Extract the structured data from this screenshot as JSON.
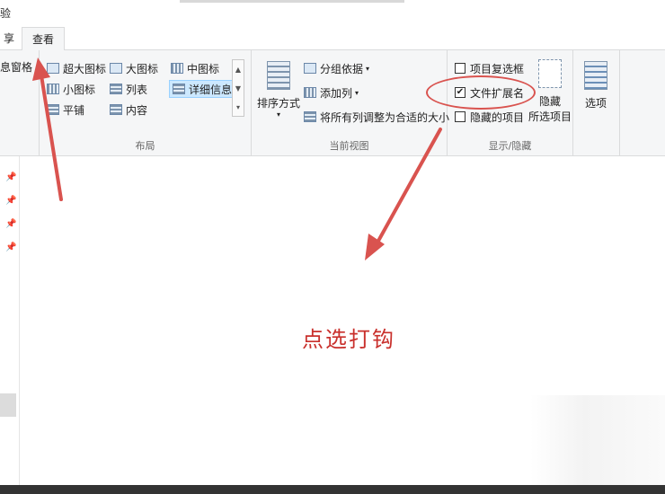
{
  "window": {
    "title_fragment": "验"
  },
  "tabs": {
    "share": "享",
    "view": "查看"
  },
  "pane_group": {
    "details_pane": "息窗格"
  },
  "layout": {
    "items": [
      "超大图标",
      "大图标",
      "中图标",
      "小图标",
      "列表",
      "详细信息",
      "平铺",
      "内容"
    ],
    "selected": "详细信息",
    "group_label": "布局"
  },
  "current_view": {
    "sort_by": "排序方式",
    "group_by": "分组依据",
    "add_columns": "添加列",
    "size_columns": "将所有列调整为合适的大小",
    "group_label": "当前视图"
  },
  "show_hide": {
    "item_checkboxes": {
      "label": "项目复选框",
      "checked": false
    },
    "file_extensions": {
      "label": "文件扩展名",
      "checked": true
    },
    "hidden_items": {
      "label": "隐藏的项目",
      "checked": false
    },
    "hide_selected": {
      "line1": "隐藏",
      "line2": "所选项目"
    },
    "group_label": "显示/隐藏"
  },
  "options": {
    "label": "选项"
  },
  "annotation": {
    "caption": "点选打钩",
    "color": "#c9302c"
  },
  "colors": {
    "ribbon_bg": "#f5f6f7",
    "selected_bg": "#cce8ff",
    "accent_red": "#d9534f"
  }
}
